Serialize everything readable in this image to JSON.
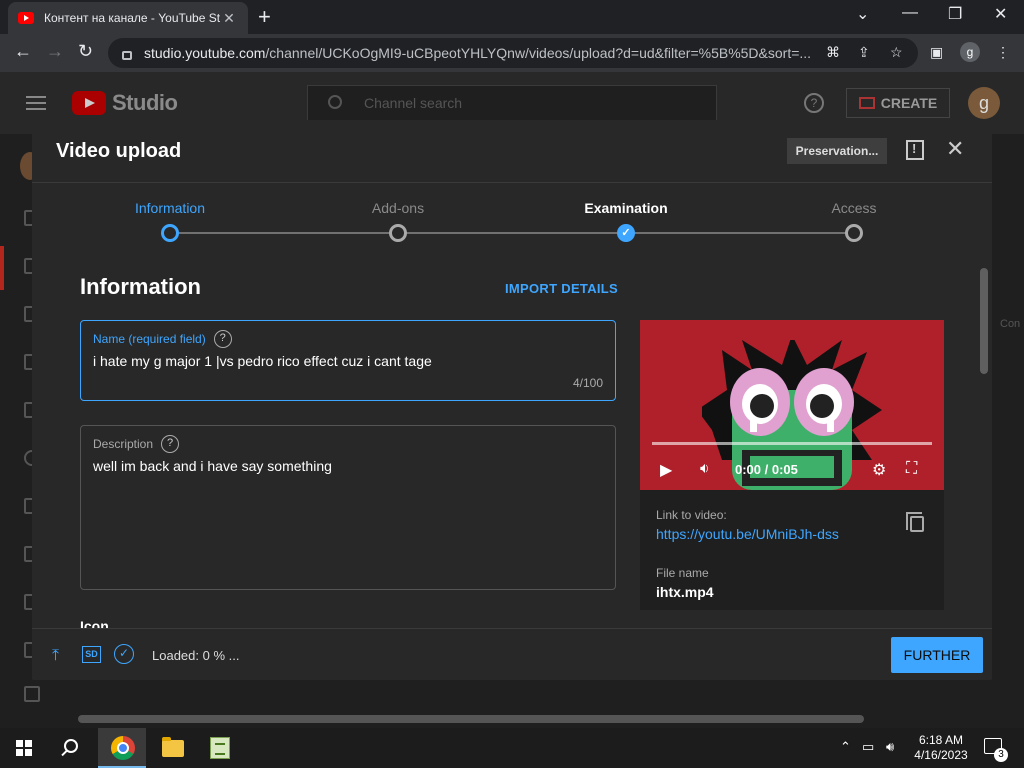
{
  "browser": {
    "tab_title": "Контент на канале - YouTube St",
    "url_domain": "studio.youtube.com",
    "url_path": "/channel/UCKoOgMI9-uCBpeotYHLYQnw/videos/upload?d=ud&filter=%5B%5D&sort=...",
    "profile_initial": "g"
  },
  "studio": {
    "logo_text": "Studio",
    "search_placeholder": "Channel search",
    "create_label": "CREATE",
    "avatar_initial": "g",
    "side_text": "Con"
  },
  "dialog": {
    "title": "Video upload",
    "preservation_label": "Preservation...",
    "steps": [
      {
        "label": "Information",
        "state": "active"
      },
      {
        "label": "Add-ons",
        "state": "pending"
      },
      {
        "label": "Examination",
        "state": "done"
      },
      {
        "label": "Access",
        "state": "pending"
      }
    ],
    "section_title": "Information",
    "import_label": "IMPORT DETAILS",
    "name_field": {
      "label": "Name (required field)",
      "value": "i hate my g major 1 |vs pedro rico effect cuz i cant tage",
      "counter": "4/100"
    },
    "description_field": {
      "label": "Description",
      "value": "well im back and i have say something"
    },
    "icon_heading": "Icon",
    "preview": {
      "time": "0:00 / 0:05",
      "link_label": "Link to video:",
      "link": "https://youtu.be/UMniBJh-dss",
      "filename_label": "File name",
      "filename": "ihtx.mp4"
    },
    "footer": {
      "sd_label": "SD",
      "loaded_text": "Loaded: 0 % ...",
      "further_label": "FURTHER"
    }
  },
  "taskbar": {
    "time": "6:18 AM",
    "date": "4/16/2023",
    "notification_count": "3"
  },
  "colors": {
    "accent": "#3ea6ff",
    "dialog_bg": "#282828",
    "video_bg": "#b0202a"
  }
}
